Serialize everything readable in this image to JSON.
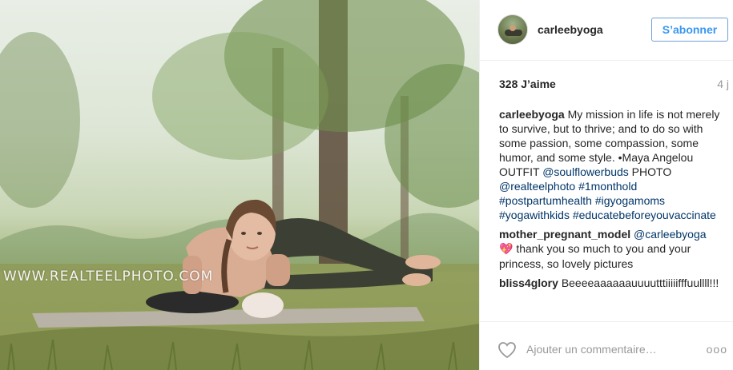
{
  "photo": {
    "watermark": "WWW.REALTEELPHOTO.COM"
  },
  "header": {
    "username": "carleebyoga",
    "follow_label": "S’abonner"
  },
  "stats": {
    "likes": "328 J’aime",
    "time": "4 j"
  },
  "caption": {
    "user": "carleebyoga",
    "text": " My mission in life is not merely to survive, but to thrive; and to do so with some passion, some compassion, some humor, and some style. •Maya Angelou OUTFIT ",
    "mention_outfit": "@soulflowerbuds",
    "photo_word": " PHOTO ",
    "mention_photo": "@realteelphoto",
    "hashtags": [
      "#1monthold",
      "#postpartumhealth",
      "#igyogamoms",
      "#yogawithkids",
      "#educatebeforeyouvaccinate"
    ]
  },
  "comments": [
    {
      "user": "mother_pregnant_model",
      "mention": "@carleebyoga",
      "emoji": "💖",
      "text": " thank you so much to you and your princess, so lovely pictures"
    },
    {
      "user": "bliss4glory",
      "text": "Beeeeaaaaaauuuutttiiiiifffuullll!!!"
    }
  ],
  "footer": {
    "add_comment_placeholder": "Ajouter un commentaire…",
    "more_label": "ooo"
  },
  "colors": {
    "link": "#003569",
    "follow_text": "#3897f0",
    "muted": "#999999"
  },
  "icons": {
    "like": "heart-outline-icon",
    "more": "more-options-icon"
  }
}
